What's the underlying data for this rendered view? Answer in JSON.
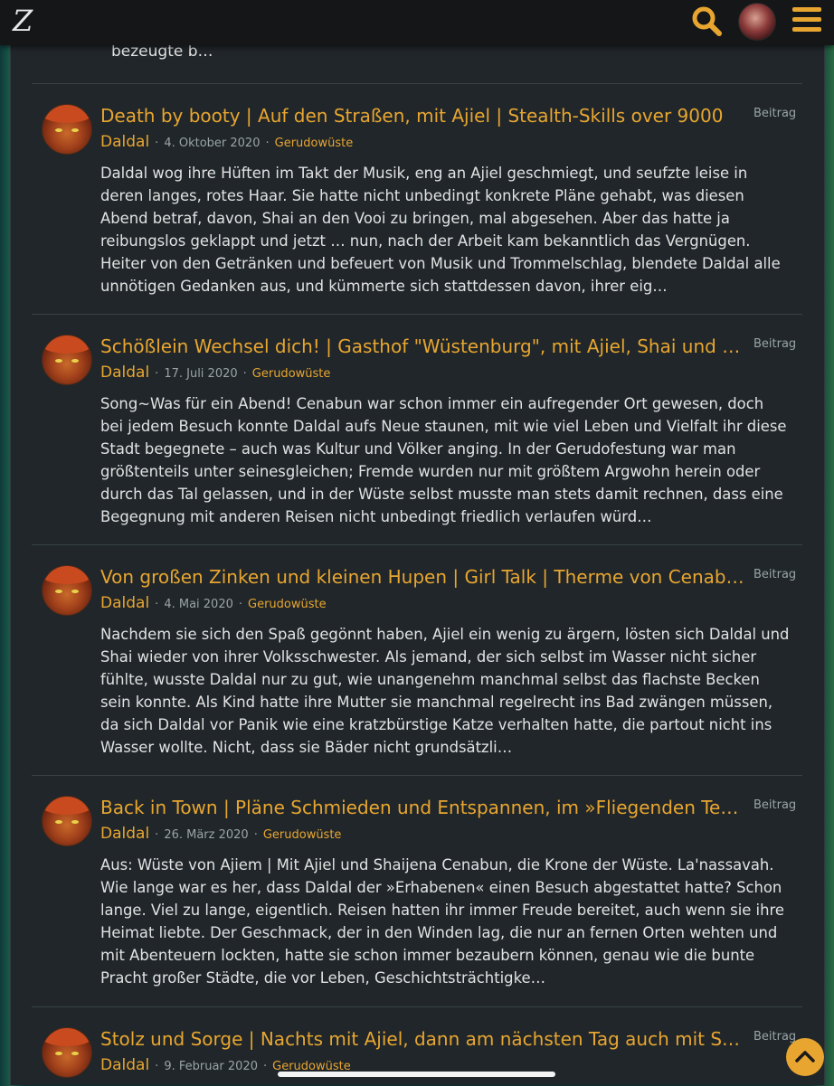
{
  "app": {
    "logo_letter": "Z",
    "accent_color": "#e8a630"
  },
  "icons": {
    "logo": "zelda-z-logo",
    "search": "search-icon",
    "avatar": "user-avatar",
    "menu": "hamburger-menu-icon",
    "scroll_top": "chevron-up-icon"
  },
  "previous_post": {
    "tail_text": "bezeugte b…"
  },
  "posts": [
    {
      "title": "Death by booty | Auf den Straßen, mit Ajiel | Stealth-Skills over 9000",
      "type": "Beitrag",
      "author": "Daldal",
      "date": "4. Oktober 2020",
      "forum": "Gerudowüste",
      "snippet": "Daldal wog ihre Hüften im Takt der Musik, eng an Ajiel geschmiegt, und seufzte leise in deren langes, rotes Haar. Sie hatte nicht unbedingt konkrete Pläne gehabt, was diesen Abend betraf, davon, Shai an den Vooi zu bringen, mal abgesehen. Aber das hatte ja reibungslos geklappt und jetzt … nun, nach der Arbeit kam bekanntlich das Vergnügen. Heiter von den Getränken und befeuert von Musik und Trommelschlag, blendete Daldal alle unnötigen Gedanken aus, und kümmerte sich stattdessen davon, ihrer eig…"
    },
    {
      "title": "Schößlein Wechsel dich! | Gasthof \"Wüstenburg\", mit Ajiel, Shai und Konsorten",
      "type": "Beitrag",
      "author": "Daldal",
      "date": "17. Juli 2020",
      "forum": "Gerudowüste",
      "snippet": "Song~Was für ein Abend! Cenabun war schon immer ein aufregender Ort gewesen, doch bei jedem Besuch konnte Daldal aufs Neue staunen, mit wie viel Leben und Vielfalt ihr diese Stadt begegnete – auch was Kultur und Völker anging. In der Gerudofestung war man größtenteils unter seinesgleichen; Fremde wurden nur mit größtem Argwohn herein oder durch das Tal gelassen, und in der Wüste selbst musste man stets damit rechnen, dass eine Begegnung mit anderen Reisen nicht unbedingt friedlich verlaufen würd…"
    },
    {
      "title": "Von großen Zinken und kleinen Hupen | Girl Talk | Therme von Cenabun, mit Ajiel",
      "type": "Beitrag",
      "author": "Daldal",
      "date": "4. Mai 2020",
      "forum": "Gerudowüste",
      "snippet": "Nachdem sie sich den Spaß gegönnt haben, Ajiel ein wenig zu ärgern, lösten sich Daldal und Shai wieder von ihrer Volksschwester. Als jemand, der sich selbst im Wasser nicht sicher fühlte, wusste Daldal nur zu gut, wie unangenehm manchmal selbst das flachste Becken sein konnte. Als Kind hatte ihre Mutter sie manchmal regelrecht ins Bad zwängen müssen, da sich Daldal vor Panik wie eine kratzbürstige Katze verhalten hatte, die partout nicht ins Wasser wollte. Nicht, dass sie Bäder nicht grundsätzli…"
    },
    {
      "title": "Back in Town | Pläne Schmieden und Entspannen, im »Fliegenden Teppich« | mit Ajiel",
      "type": "Beitrag",
      "author": "Daldal",
      "date": "26. März 2020",
      "forum": "Gerudowüste",
      "snippet": "Aus: Wüste von Ajiem | Mit Ajiel und Shaijena Cenabun, die Krone der Wüste. La'nassavah. Wie lange war es her, dass Daldal der »Erhabenen« einen Besuch abgestattet hatte? Schon lange. Viel zu lange, eigentlich. Reisen hatten ihr immer Freude bereitet, auch wenn sie ihre Heimat liebte. Der Geschmack, der in den Winden lag, die nur an fernen Orten wehten und mit Abenteuern lockten, hatte sie schon immer bezaubern können, genau wie die bunte Pracht großer Städte, die vor Leben, Geschichtsträchtigke…"
    },
    {
      "title": "Stolz und Sorge | Nachts mit Ajiel, dann am nächsten Tag auch mit Shai und Sarah",
      "type": "Beitrag",
      "author": "Daldal",
      "date": "9. Februar 2020",
      "forum": "Gerudowüste",
      "snippet": ""
    }
  ]
}
